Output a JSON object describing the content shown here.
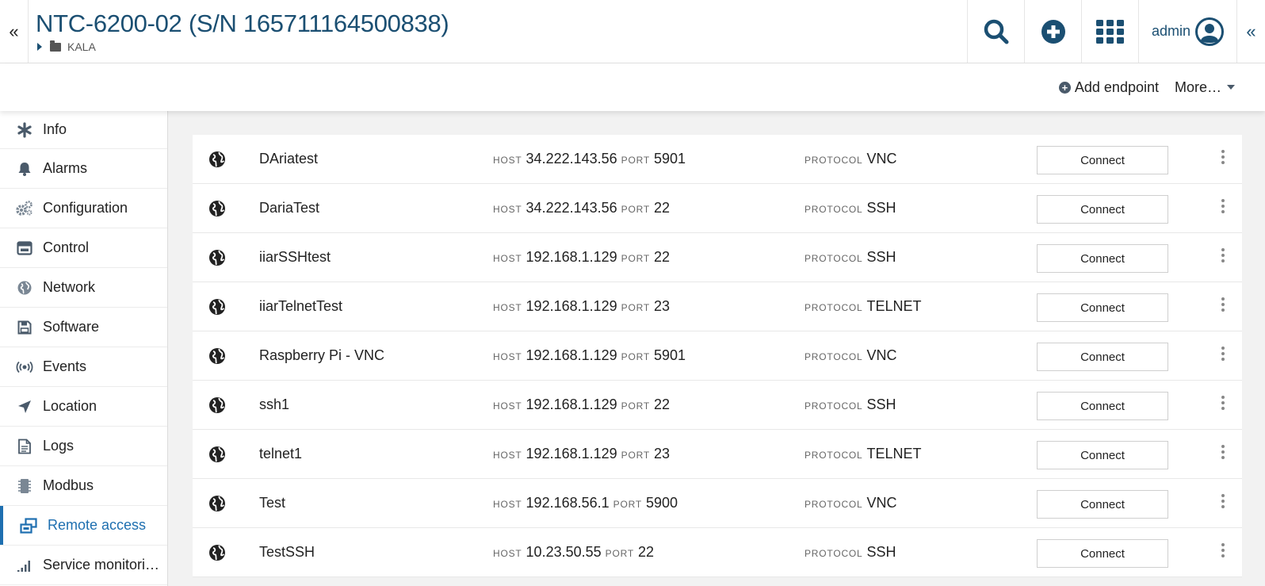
{
  "header": {
    "title": "NTC-6200-02 (S/N 165711164500838)",
    "breadcrumb": "KALA",
    "user": "admin",
    "collapse_left_icon": "«",
    "collapse_right_icon": "«"
  },
  "actionbar": {
    "add_endpoint_label": "Add endpoint",
    "more_label": "More…"
  },
  "sidebar": {
    "items": [
      {
        "label": "Info",
        "icon": "asterisk-icon"
      },
      {
        "label": "Alarms",
        "icon": "bell-icon"
      },
      {
        "label": "Configuration",
        "icon": "gears-icon"
      },
      {
        "label": "Control",
        "icon": "control-icon"
      },
      {
        "label": "Network",
        "icon": "globe-icon"
      },
      {
        "label": "Software",
        "icon": "floppy-icon"
      },
      {
        "label": "Events",
        "icon": "broadcast-icon"
      },
      {
        "label": "Location",
        "icon": "location-arrow-icon"
      },
      {
        "label": "Logs",
        "icon": "document-icon"
      },
      {
        "label": "Modbus",
        "icon": "chip-icon"
      },
      {
        "label": "Remote access",
        "icon": "remote-access-icon",
        "active": true
      },
      {
        "label": "Service monitori…",
        "icon": "signal-bars-icon"
      }
    ]
  },
  "labels": {
    "host": "HOST",
    "port": "PORT",
    "protocol": "PROTOCOL",
    "connect": "Connect"
  },
  "endpoints": [
    {
      "name": "DAriatest",
      "host": "34.222.143.56",
      "port": "5901",
      "protocol": "VNC"
    },
    {
      "name": "DariaTest",
      "host": "34.222.143.56",
      "port": "22",
      "protocol": "SSH"
    },
    {
      "name": "iiarSSHtest",
      "host": "192.168.1.129",
      "port": "22",
      "protocol": "SSH"
    },
    {
      "name": "iiarTelnetTest",
      "host": "192.168.1.129",
      "port": "23",
      "protocol": "TELNET"
    },
    {
      "name": "Raspberry Pi - VNC",
      "host": "192.168.1.129",
      "port": "5901",
      "protocol": "VNC"
    },
    {
      "name": "ssh1",
      "host": "192.168.1.129",
      "port": "22",
      "protocol": "SSH"
    },
    {
      "name": "telnet1",
      "host": "192.168.1.129",
      "port": "23",
      "protocol": "TELNET"
    },
    {
      "name": "Test",
      "host": "192.168.56.1",
      "port": "5900",
      "protocol": "VNC"
    },
    {
      "name": "TestSSH",
      "host": "10.23.50.55",
      "port": "22",
      "protocol": "SSH"
    }
  ],
  "colors": {
    "accent": "#1e6fb0",
    "title": "#1b4f72",
    "icon_dark": "#1b4f72"
  }
}
